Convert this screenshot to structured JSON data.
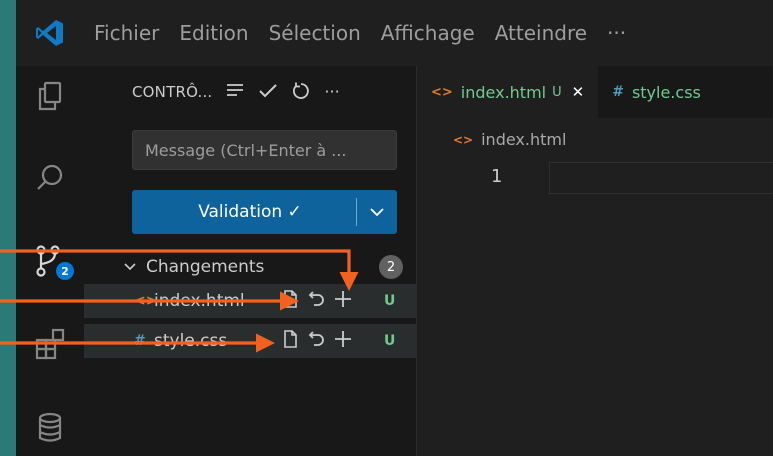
{
  "menu": [
    "Fichier",
    "Edition",
    "Sélection",
    "Affichage",
    "Atteindre",
    "···"
  ],
  "activity_bar": {
    "items": [
      "explorer-icon",
      "search-icon",
      "source-control-icon",
      "extensions-icon",
      "database-icon"
    ],
    "scm_badge": "2"
  },
  "scm": {
    "title": "CONTRÔ...",
    "tool_icons": [
      "list-icon",
      "check-icon",
      "refresh-icon",
      "more-icon"
    ],
    "more_label": "···",
    "message_placeholder": "Message (Ctrl+Enter à ...",
    "commit_label": "Validation ✓",
    "changes": {
      "label": "Changements",
      "count": "2",
      "files": [
        {
          "name": "index.html",
          "status": "U",
          "icon_glyph": "<>",
          "icon_color": "#e37933"
        },
        {
          "name": "style.css",
          "status": "U",
          "icon_glyph": "#",
          "icon_color": "#519aba"
        }
      ]
    }
  },
  "editor": {
    "tabs": [
      {
        "name": "index.html",
        "status": "U",
        "close": "✕",
        "icon_glyph": "<>",
        "active": true
      },
      {
        "name": "style.css",
        "icon_glyph": "#",
        "active": false
      }
    ],
    "breadcrumb": "index.html",
    "breadcrumb_icon": "<>",
    "line_number": "1"
  },
  "colors": {
    "background": "#2b7a78",
    "accent": "#0e639c",
    "html_icon": "#e37933",
    "css_icon": "#519aba",
    "untracked": "#73c991",
    "annotation_arrow": "#f2611d"
  }
}
